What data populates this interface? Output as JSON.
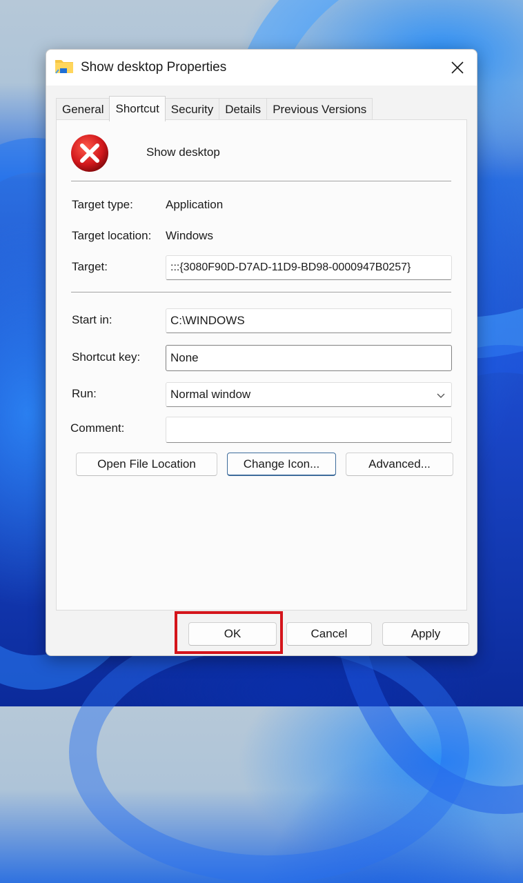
{
  "window": {
    "title": "Show desktop Properties",
    "title_icon": "folder-shortcut-icon",
    "close_icon": "close-icon"
  },
  "tabs": [
    {
      "label": "General",
      "active": false
    },
    {
      "label": "Shortcut",
      "active": true
    },
    {
      "label": "Security",
      "active": false
    },
    {
      "label": "Details",
      "active": false
    },
    {
      "label": "Previous Versions",
      "active": false
    }
  ],
  "shortcut": {
    "app_icon": "error-x-icon",
    "app_name": "Show desktop",
    "target_type_label": "Target type:",
    "target_type_value": "Application",
    "target_location_label": "Target location:",
    "target_location_value": "Windows",
    "target_label": "Target:",
    "target_value": ":::{3080F90D-D7AD-11D9-BD98-0000947B0257}",
    "start_in_label": "Start in:",
    "start_in_value": "C:\\WINDOWS",
    "shortcut_key_label": "Shortcut key:",
    "shortcut_key_value": "None",
    "run_label": "Run:",
    "run_value": "Normal window",
    "comment_label": "Comment:",
    "comment_value": "",
    "open_file_location_label": "Open File Location",
    "change_icon_label": "Change Icon...",
    "advanced_label": "Advanced..."
  },
  "footer": {
    "ok_label": "OK",
    "cancel_label": "Cancel",
    "apply_label": "Apply"
  },
  "annotation": {
    "highlight_color": "#d4141b",
    "highlighted": "OK"
  }
}
